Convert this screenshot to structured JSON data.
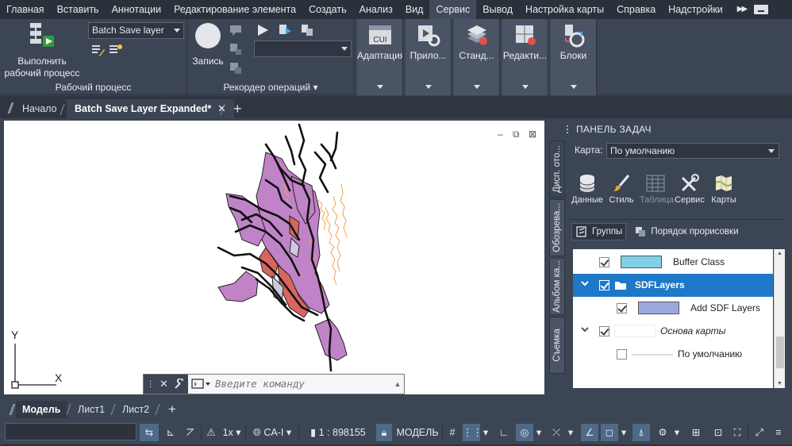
{
  "menu": {
    "items": [
      "Главная",
      "Вставить",
      "Аннотации",
      "Редактирование элемента",
      "Создать",
      "Анализ",
      "Вид",
      "Сервис",
      "Вывод",
      "Настройка карты",
      "Справка",
      "Надстройки"
    ],
    "active_index": 7,
    "more_icon": "double-chevron-right-icon"
  },
  "ribbon": {
    "workflow": {
      "run_label_line1": "Выполнить",
      "run_label_line2": "рабочий процесс",
      "selected_workflow": "Batch Save layer",
      "group_title": "Рабочий процесс"
    },
    "recorder": {
      "record_label": "Запись",
      "macro_select_value": "",
      "group_title": "Рекордер операций"
    },
    "tiles": [
      "Адаптация",
      "Прило...",
      "Станд...",
      "Редакти...",
      "Блоки"
    ],
    "cui_text": "CUI"
  },
  "doc_tabs": {
    "start": "Начало",
    "active": "Batch Save Layer Expanded*",
    "close": "✕",
    "new": "+"
  },
  "viewport": {
    "axis_y": "Y",
    "axis_x": "X",
    "ctrl_minimize": "–",
    "ctrl_restore": "⧉",
    "ctrl_close": "⊠"
  },
  "command_line": {
    "placeholder": "Введите команду",
    "close": "✕"
  },
  "task_pane": {
    "title": "ПАНЕЛЬ ЗАДАЧ",
    "vertical_tabs": [
      "Дисп. ото...",
      "Обозрева...",
      "Альбом ка...",
      "Съемка"
    ],
    "map_label": "Карта:",
    "map_value": "По умолчанию",
    "tools": [
      {
        "label": "Данные",
        "icon": "database-icon",
        "disabled": false
      },
      {
        "label": "Стиль",
        "icon": "brush-icon",
        "disabled": false
      },
      {
        "label": "Таблица",
        "icon": "table-icon",
        "disabled": true
      },
      {
        "label": "Сервис",
        "icon": "tools-icon",
        "disabled": false
      },
      {
        "label": "Карты",
        "icon": "map-icon",
        "disabled": false
      }
    ],
    "groups_label": "Группы",
    "draw_order_label": "Порядок прорисовки",
    "layers": [
      {
        "label": "Buffer Class",
        "swatch": "#7fd0e8",
        "checked": true,
        "selected": false,
        "italic": false,
        "expandable": false,
        "folder": false
      },
      {
        "label": "SDFLayers",
        "swatch": "",
        "checked": true,
        "selected": true,
        "italic": false,
        "expandable": true,
        "folder": true
      },
      {
        "label": "Add SDF Layers",
        "swatch": "#9ea8e0",
        "checked": true,
        "selected": false,
        "italic": false,
        "expandable": false,
        "folder": false
      },
      {
        "label": "Основа карты",
        "swatch": "",
        "checked": true,
        "selected": false,
        "italic": true,
        "expandable": true,
        "folder": false
      },
      {
        "label": "По умолчанию",
        "swatch": "",
        "checked": false,
        "selected": false,
        "italic": false,
        "expandable": false,
        "folder": false
      }
    ]
  },
  "layout_tabs": {
    "model": "Модель",
    "sheet1": "Лист1",
    "sheet2": "Лист2",
    "new": "+"
  },
  "status_bar": {
    "scale_factor": "1x",
    "coord_system": "CA-I",
    "scale": "1 : 898155",
    "model": "МОДЕЛЬ"
  },
  "colors": {
    "map_purple": "#c183c8",
    "map_orange": "#f5a04a",
    "map_red": "#d9665e",
    "map_black": "#111111",
    "selection_blue": "#1e78c8"
  }
}
